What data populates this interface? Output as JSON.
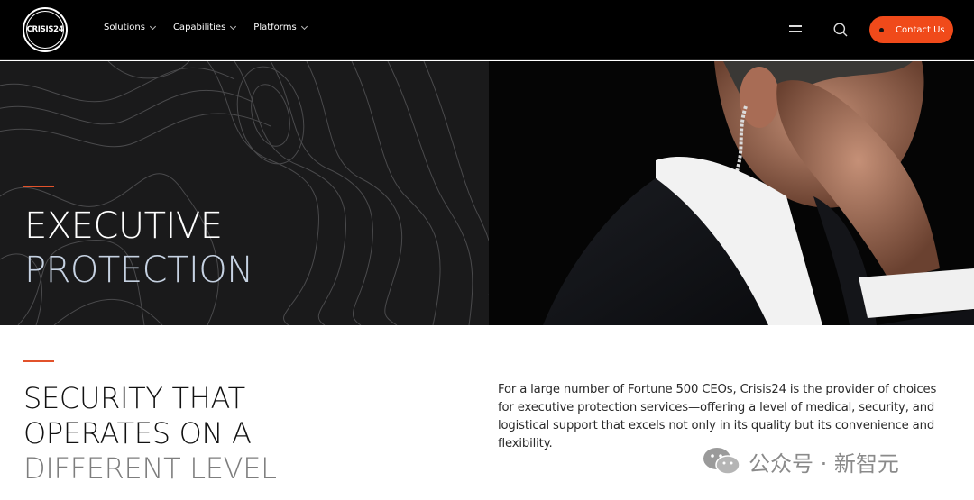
{
  "brand": {
    "logo_text": "CRISIS24",
    "accent_color": "#f04a1a"
  },
  "nav": {
    "items": [
      {
        "label": "Solutions",
        "icon": "chevron-down-icon"
      },
      {
        "label": "Capabilities",
        "icon": "chevron-down-icon"
      },
      {
        "label": "Platforms",
        "icon": "chevron-down-icon"
      }
    ],
    "menu_icon": "hamburger-icon",
    "search_icon": "search-icon",
    "contact_label": "Contact Us"
  },
  "hero": {
    "title_line1": "EXECUTIVE",
    "title_line2": "PROTECTION",
    "image": "security-agent-earpiece-photo"
  },
  "section": {
    "title_line1": "SECURITY THAT",
    "title_line2": "OPERATES ON A",
    "title_line3": "DIFFERENT LEVEL",
    "body": "For a large number of Fortune 500 CEOs, Crisis24 is the provider of choices for executive protection services—offering a level of medical, security, and logistical support that excels not only in its quality but its convenience and flexibility."
  },
  "watermark": {
    "text": "公众号 · 新智元",
    "icon": "wechat-icon"
  }
}
